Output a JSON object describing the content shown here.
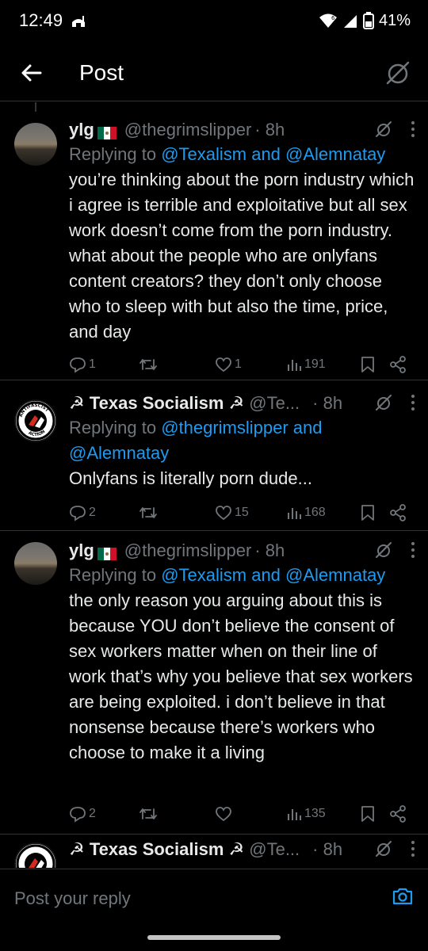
{
  "status_bar": {
    "time": "12:49",
    "battery": "41%"
  },
  "header": {
    "title": "Post"
  },
  "tweets": [
    {
      "name": "ylg",
      "handle": "@thegrimslipper",
      "time": "· 8h",
      "replying_prefix": "Replying to ",
      "replying_to": "@Texalism and @Alemnatay",
      "text": "you’re thinking about the porn industry which i agree is terrible and exploitative but all sex work doesn’t come from the porn industry. what about the people who are onlyfans content creators? they don’t only choose who to sleep with but also the time, price, and day",
      "replies": "1",
      "reposts": "",
      "likes": "1",
      "views": "191"
    },
    {
      "name": "☭ Texas Socialism ☭",
      "handle": "@Te...",
      "time": "· 8h",
      "replying_prefix": "Replying to ",
      "replying_to": "@thegrimslipper and @Alemnatay",
      "text": "Onlyfans is literally porn dude...",
      "replies": "2",
      "reposts": "",
      "likes": "15",
      "views": "168"
    },
    {
      "name": "ylg",
      "handle": "@thegrimslipper",
      "time": "· 8h",
      "replying_prefix": "Replying to ",
      "replying_to": "@Texalism and @Alemnatay",
      "text": "the only reason you arguing about this is because YOU don’t believe the consent of sex workers matter when on their line of work that’s why you believe that sex workers are being exploited. i don’t believe in that nonsense because there’s workers who choose to make it a living",
      "replies": "2",
      "reposts": "",
      "likes": "",
      "views": "135"
    },
    {
      "name": "☭ Texas Socialism ☭",
      "handle": "@Te...",
      "time": "· 8h"
    }
  ],
  "composer": {
    "placeholder": "Post your reply"
  },
  "avatar_antifa": {
    "top_text": "ANTIFASCIST",
    "bottom_text": "ACTION"
  },
  "colors": {
    "background": "#000000",
    "text": "#e7e9ea",
    "secondary": "#71767b",
    "link": "#1d9bf0",
    "divider": "#2f3336"
  }
}
